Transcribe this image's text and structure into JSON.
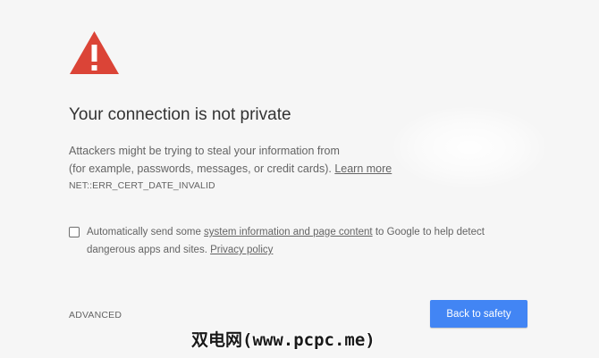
{
  "colors": {
    "background": "#f6f6f6",
    "warning_red": "#db4437",
    "primary_button": "#4285f4",
    "title_text": "#333333",
    "body_text": "#646464"
  },
  "icon": {
    "name": "warning-triangle-icon"
  },
  "heading": {
    "title": "Your connection is not private"
  },
  "description": {
    "line1": "Attackers might be trying to steal your information from",
    "line2_prefix": "(for example, passwords, messages, or credit cards). ",
    "learn_more": "Learn more"
  },
  "error_code": "NET::ERR_CERT_DATE_INVALID",
  "opt_in": {
    "checked": false,
    "text_prefix": "Automatically send some ",
    "system_info_link": "system information and page content",
    "text_middle": " to Google to help detect",
    "line2_prefix": "dangerous apps and sites. ",
    "privacy_link": "Privacy policy"
  },
  "footer": {
    "advanced_label": "ADVANCED",
    "back_button_label": "Back to safety"
  },
  "watermark": {
    "text": "双电网(www.pcpc.me)"
  }
}
